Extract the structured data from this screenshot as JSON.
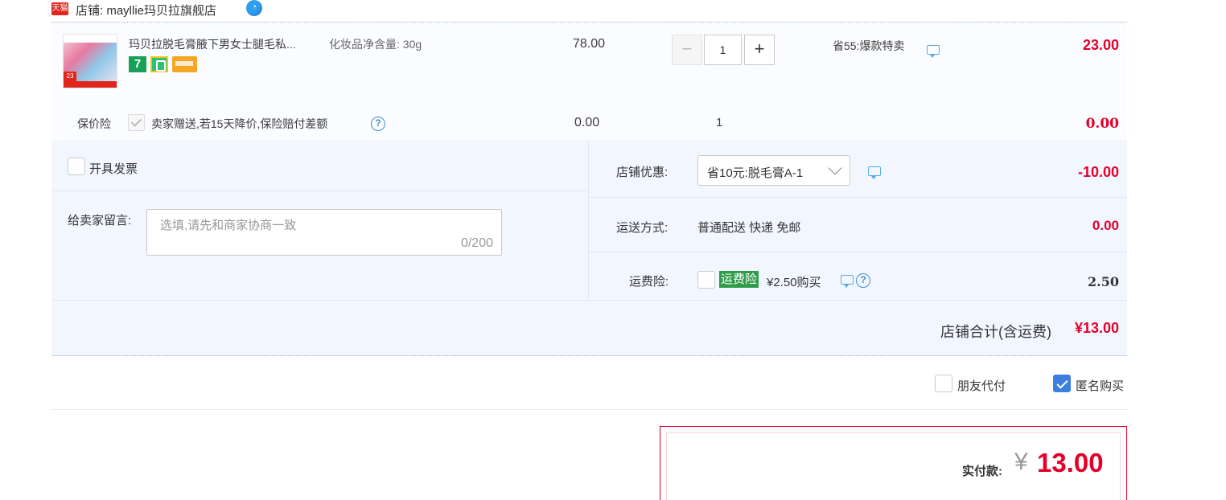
{
  "shop": {
    "badge": "天猫",
    "label": "店铺: mayllie玛贝拉旗舰店",
    "wangwang_glyph": "◔"
  },
  "item": {
    "thumb_badge": "23",
    "title": "玛贝拉脱毛膏腋下男女士腿毛私...",
    "sku": "化妆品净含量: 30g",
    "service_7day": "7",
    "price": "78.00",
    "qty_minus": "−",
    "qty": "1",
    "qty_plus": "+",
    "promo": "省55:爆款特卖",
    "subtotal": "23.00"
  },
  "insurance": {
    "label": "保价险",
    "desc": "卖家赠送,若15天降价,保险赔付差额",
    "help": "?",
    "price": "0.00",
    "qty": "1",
    "subtotal": "0.00"
  },
  "options": {
    "invoice_label": "开具发票",
    "message_label": "给卖家留言:",
    "message_placeholder": "选填,请先和商家协商一致",
    "message_count": "0/200",
    "discount_label": "店铺优惠:",
    "discount_value": "省10元:脱毛膏A-1",
    "discount_amount": "-10.00",
    "shipping_label": "运送方式:",
    "shipping_value": "普通配送 快递 免邮",
    "shipping_amount": "0.00",
    "freight_ins_label": "运费险:",
    "freight_ins_badge": "运费险",
    "freight_ins_text": "¥2.50购买",
    "freight_ins_help": "?",
    "freight_ins_amount": "2.50",
    "shop_total_label": "店铺合计(含运费)",
    "shop_total_amount": "¥13.00"
  },
  "extras": {
    "friend_pay_label": "朋友代付",
    "anonymous_label": "匿名购买",
    "anonymous_checked": true
  },
  "pay": {
    "label": "实付款:",
    "currency": "¥",
    "amount": "13.00"
  },
  "colors": {
    "price_red": "#e4002b",
    "panel_bg": "#f2f7ff",
    "checkbox_blue": "#3d7fe0",
    "freight_badge_green": "#2f9c4a"
  }
}
